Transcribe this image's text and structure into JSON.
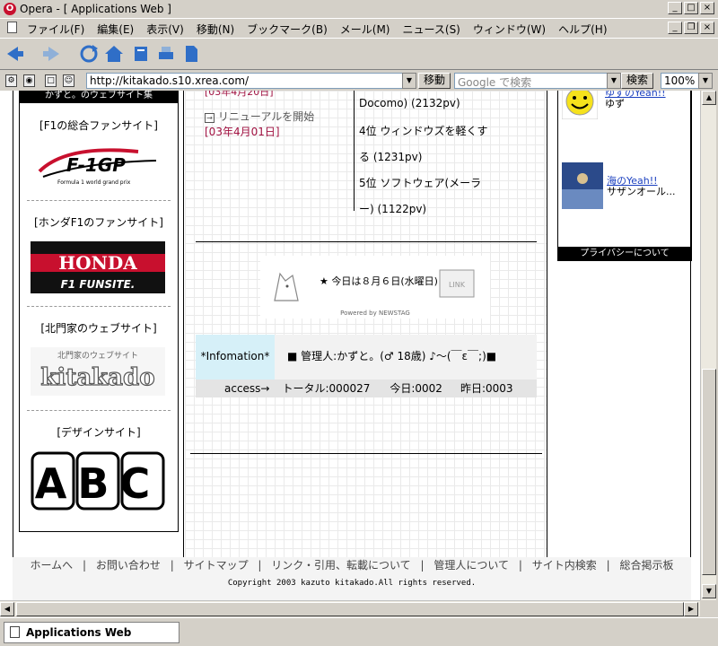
{
  "window": {
    "title": "Opera - [ Applications Web ]",
    "logo_glyph": "O"
  },
  "menu": {
    "items": [
      "ファイル(F)",
      "編集(E)",
      "表示(V)",
      "移動(N)",
      "ブックマーク(B)",
      "メール(M)",
      "ニュース(S)",
      "ウィンドウ(W)",
      "ヘルプ(H)"
    ]
  },
  "address_bar": {
    "url": "http://kitakado.s10.xrea.com/",
    "go_label": "移動",
    "search_placeholder": "Google で検索",
    "search_button": "検索",
    "zoom": "100%"
  },
  "left": {
    "header": "かずと。のウェブサイト集",
    "sections": [
      {
        "label": "[F1の総合ファンサイト]",
        "banner": "F-1GP",
        "banner_sub": "Formula 1 world grand prix"
      },
      {
        "label": "[ホンダF1のファンサイト]",
        "banner": "HONDA",
        "banner_sub": "F1  FUNSITE."
      },
      {
        "label": "[北門家のウェブサイト]",
        "banner": "kitakado",
        "banner_sub": "北門家のウェブサイト"
      },
      {
        "label": "[デザインサイト]",
        "banner": "ABC"
      }
    ]
  },
  "center": {
    "news_partial": "[03年4月20日]",
    "news_item": {
      "title": "リニューアルを開始",
      "date": "[03年4月01日]"
    },
    "ranking": [
      "Docomo) (2132pv)",
      "4位 ウィンドウズを軽くす",
      "る (1231pv)",
      "5位 ソフトウェア(メーラ",
      "ー) (1122pv)"
    ],
    "newstag": {
      "text": "★ 今日は８月６日(水曜日)",
      "powered": "Powered by NEWSTAG",
      "link_tag": "LINK"
    },
    "info": {
      "label": "*Infomation*",
      "message": "■ 管理人:かずと。(♂ 18歳) ♪〜(￣ε￣;)■",
      "access_label": "access→",
      "total": "トータル:000027",
      "today": "今日:0002",
      "yesterday": "昨日:0003"
    }
  },
  "right": {
    "item1": {
      "link": "ゆずのYeah!!",
      "text": "ゆず"
    },
    "item2": {
      "link": "海のYeah!!",
      "text": "サザンオール..."
    },
    "privacy": "プライバシーについて"
  },
  "footer": {
    "links": [
      "ホームへ",
      "お問い合わせ",
      "サイトマップ",
      "リンク・引用、転載について",
      "管理人について",
      "サイト内検索",
      "総合掲示板"
    ],
    "separator": "|",
    "copyright": "Copyright 2003 kazuto kitakado.All rights reserved."
  },
  "status": {
    "tab_label": "Applications Web"
  }
}
